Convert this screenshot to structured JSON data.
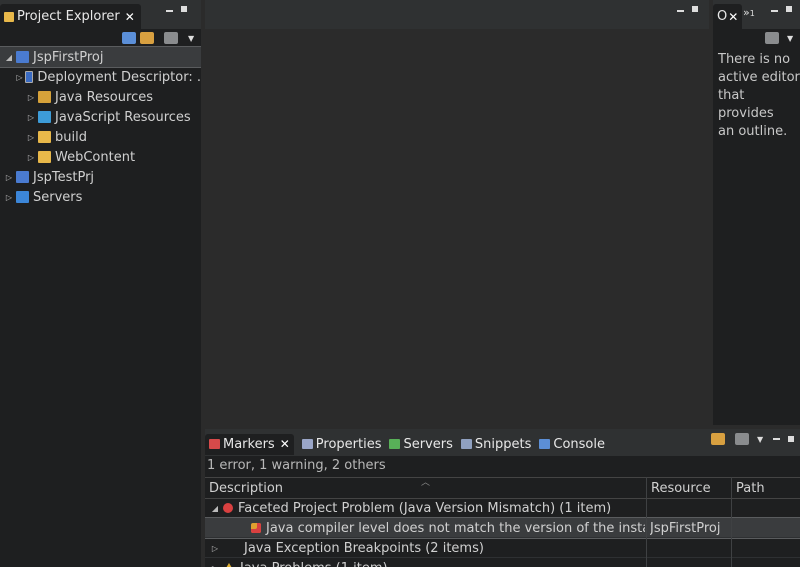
{
  "project_explorer": {
    "tab_label": "Project Explorer",
    "tree": [
      {
        "label": "JspFirstProj",
        "level": 0,
        "expanded": true,
        "icon": "project-icon"
      },
      {
        "label": "Deployment Descriptor: .",
        "level": 1,
        "expanded": false,
        "icon": "deployment-descriptor-icon"
      },
      {
        "label": "Java Resources",
        "level": 1,
        "expanded": false,
        "icon": "java-resources-icon"
      },
      {
        "label": "JavaScript Resources",
        "level": 1,
        "expanded": false,
        "icon": "javascript-resources-icon"
      },
      {
        "label": "build",
        "level": 1,
        "expanded": false,
        "icon": "folder-icon"
      },
      {
        "label": "WebContent",
        "level": 1,
        "expanded": false,
        "icon": "folder-icon"
      },
      {
        "label": "JspTestPrj",
        "level": 0,
        "expanded": false,
        "icon": "project-icon"
      },
      {
        "label": "Servers",
        "level": 0,
        "expanded": false,
        "icon": "servers-folder-icon"
      }
    ]
  },
  "outline": {
    "tab_label": "O",
    "overflow_label": "»",
    "overflow_count": "1",
    "message": [
      "There is no",
      "active editor",
      "that provides",
      "an outline."
    ]
  },
  "bottom": {
    "tabs": [
      {
        "label": "Markers",
        "active": true,
        "color": "#d64a4a"
      },
      {
        "label": "Properties",
        "active": false,
        "color": "#9aa6c8"
      },
      {
        "label": "Servers",
        "active": false,
        "color": "#58b058"
      },
      {
        "label": "Snippets",
        "active": false,
        "color": "#8fa0c0"
      },
      {
        "label": "Console",
        "active": false,
        "color": "#5c8fd6"
      }
    ],
    "summary": "1 error, 1 warning, 2 others",
    "columns": [
      "Description",
      "Resource",
      "Path"
    ],
    "rows": [
      {
        "indent": 0,
        "expanded": true,
        "icon": "error-icon",
        "description": "Faceted Project Problem (Java Version Mismatch) (1 item)",
        "resource": "",
        "path": ""
      },
      {
        "indent": 1,
        "expanded": null,
        "icon": "error-marker-icon",
        "description": "Java compiler level does not match the version of the installed Java",
        "resource": "JspFirstProj",
        "path": ""
      },
      {
        "indent": 0,
        "expanded": false,
        "icon": "",
        "description": "Java Exception Breakpoints (2 items)",
        "resource": "",
        "path": ""
      },
      {
        "indent": 0,
        "expanded": false,
        "icon": "warning-icon",
        "description": "Java Problems (1 item)",
        "resource": "",
        "path": ""
      }
    ]
  }
}
